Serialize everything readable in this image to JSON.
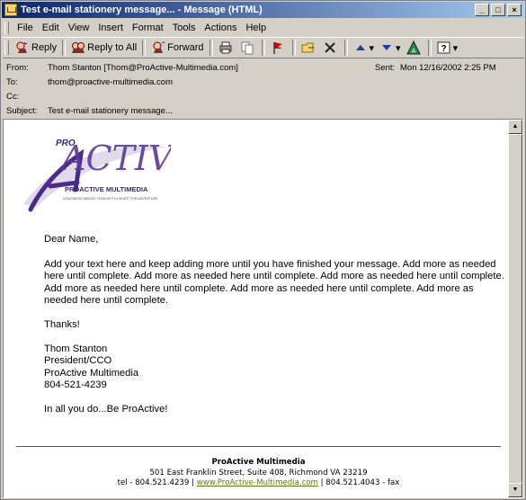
{
  "window": {
    "title": "Test e-mail stationery message... - Message (HTML)",
    "buttons": {
      "minimize": "_",
      "maximize": "□",
      "close": "×"
    }
  },
  "menu": [
    "File",
    "Edit",
    "View",
    "Insert",
    "Format",
    "Tools",
    "Actions",
    "Help"
  ],
  "toolbar": {
    "reply": "Reply",
    "reply_all": "Reply to All",
    "forward": "Forward"
  },
  "header": {
    "from_label": "From:",
    "from_value": "Thom Stanton [Thom@ProActive-Multimedia.com]",
    "to_label": "To:",
    "to_value": "thom@proactive-multimedia.com",
    "cc_label": "Cc:",
    "cc_value": "",
    "subject_label": "Subject:",
    "subject_value": "Test e-mail stationery message...",
    "sent_label": "Sent:",
    "sent_value": "Mon 12/16/2002 2:25 PM"
  },
  "logo": {
    "pro": "PRO",
    "active": "ACTIVE",
    "brand": "PROACTIVE MULTIMEDIA",
    "tagline": "A BUSINESS-MINDED TEAM WITH A HEART FOR ADVENTURE"
  },
  "message": {
    "greeting": "Dear Name,",
    "paragraph": "Add your text here and keep adding more until you have finished your message. Add more as needed here until complete. Add more as needed here until complete. Add more as needed here until complete. Add more as needed here until complete. Add more as needed here until complete. Add more as needed here until complete.",
    "thanks": "Thanks!",
    "sig_name": "Thom Stanton",
    "sig_title": "President/CCO",
    "sig_company": "ProActive Multimedia",
    "sig_phone": "804-521-4239",
    "closing": "In all you do...Be ProActive!"
  },
  "footer": {
    "company": "ProActive Multimedia",
    "address": "501 East Franklin Street, Suite 408, Richmond VA 23219",
    "tel": "tel - 804.521.4239 |",
    "website": "www.ProActive-Multimedia.com",
    "fax": "| 804.521.4043 - fax"
  },
  "colors": {
    "titlebar_start": "#0a246a",
    "titlebar_end": "#a6caf0",
    "chrome": "#d4d0c8",
    "logo_purple": "#4b2b8a",
    "footer_link": "#5c7a14"
  }
}
